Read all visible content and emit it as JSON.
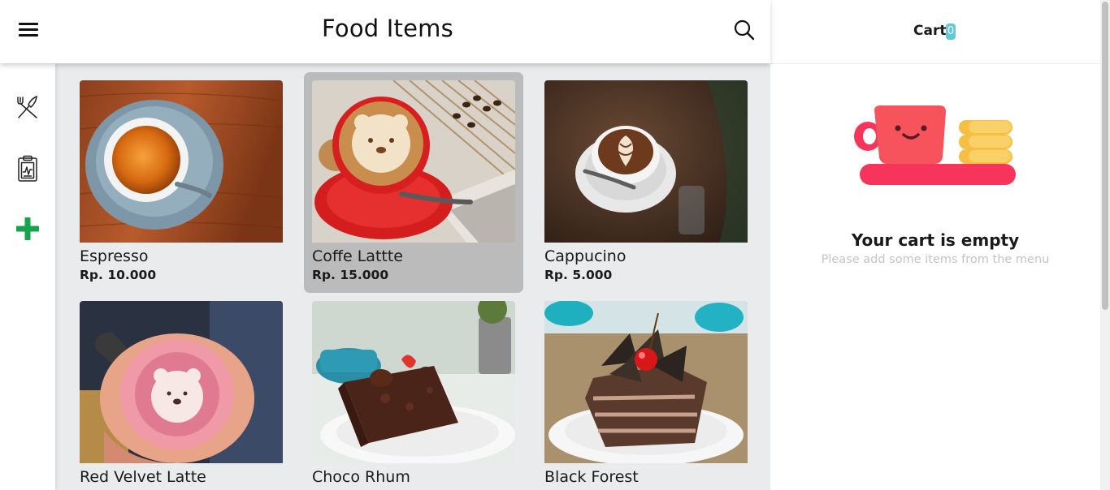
{
  "header": {
    "title": "Food Items",
    "menu_icon": "hamburger-menu-icon",
    "search_icon": "search-icon"
  },
  "sidebar": {
    "items": [
      {
        "icon": "fork-knife-icon",
        "label": "Food"
      },
      {
        "icon": "clipboard-report-icon",
        "label": "Report"
      },
      {
        "icon": "plus-icon",
        "label": "Add",
        "color": "#16a34a"
      }
    ]
  },
  "products": [
    {
      "name": "Espresso",
      "price": "Rp. 10.000",
      "selected": false
    },
    {
      "name": "Coffe Lattte",
      "price": "Rp. 15.000",
      "selected": true
    },
    {
      "name": "Cappucino",
      "price": "Rp. 5.000",
      "selected": false
    },
    {
      "name": "Red Velvet Latte",
      "price": "",
      "selected": false
    },
    {
      "name": "Choco Rhum",
      "price": "",
      "selected": false
    },
    {
      "name": "Black Forest",
      "price": "",
      "selected": false
    }
  ],
  "cart": {
    "title": "Cart",
    "count": "0",
    "empty_title": "Your cart is empty",
    "empty_subtitle": "Please add some items from the menu",
    "count_color": "#62c9d8",
    "illustration_colors": {
      "cup": "#f7535c",
      "saucer": "#f7355c",
      "cookies": "#f6bf44"
    }
  },
  "colors": {
    "content_bg": "#eaebed",
    "selected_card_bg": "#bbbbbb",
    "accent_green": "#16a34a"
  }
}
